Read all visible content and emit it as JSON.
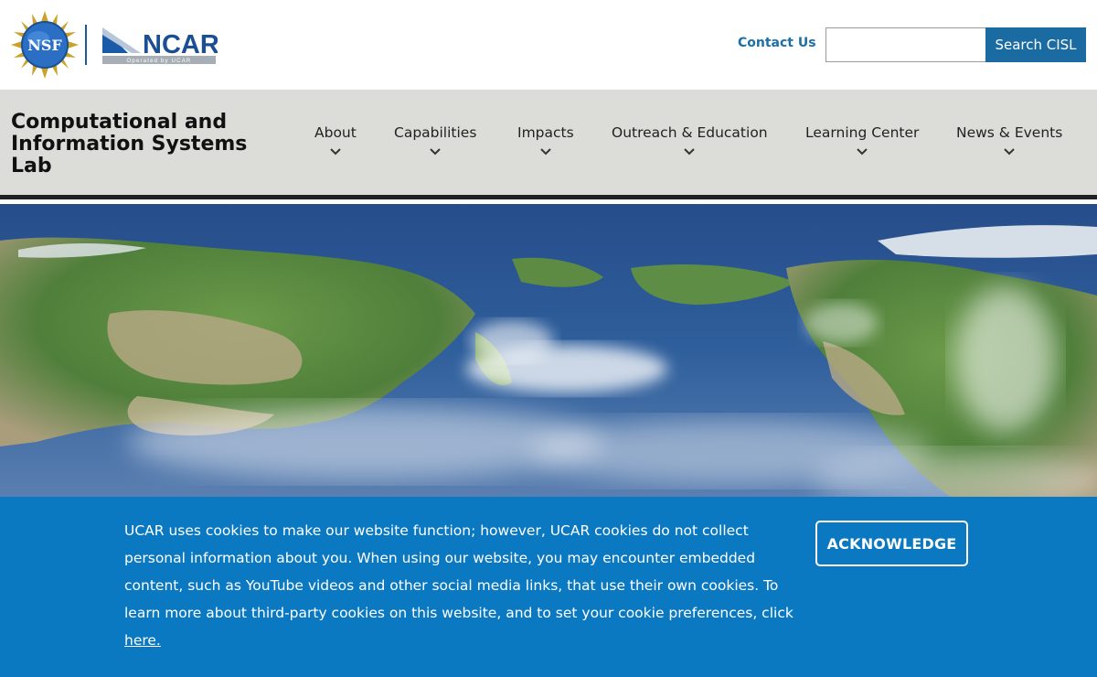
{
  "header": {
    "nsf_logo_text": "NSF",
    "ncar_logo_text": "NCAR",
    "ncar_tagline": "Operated by UCAR",
    "contact_label": "Contact Us",
    "search": {
      "value": "",
      "placeholder": ""
    },
    "search_button_label": "Search CISL"
  },
  "nav": {
    "site_title": "Computational and Information Systems Lab",
    "items": [
      {
        "label": "About",
        "icon": "chevron-down-icon"
      },
      {
        "label": "Capabilities",
        "icon": "chevron-down-icon"
      },
      {
        "label": "Impacts",
        "icon": "chevron-down-icon"
      },
      {
        "label": "Outreach & Education",
        "icon": "chevron-down-icon"
      },
      {
        "label": "Learning Center",
        "icon": "chevron-down-icon"
      },
      {
        "label": "News & Events",
        "icon": "chevron-down-icon"
      }
    ]
  },
  "cookie_banner": {
    "message": "UCAR uses cookies to make our website function; however, UCAR cookies do not collect personal information about you. When using our website, you may encounter embedded content, such as YouTube videos and other social media links, that use their own cookies. To learn more about third-party cookies on this website, and to set your cookie preferences, click",
    "link_label": "here.",
    "button_label": "ACKNOWLEDGE"
  },
  "colors": {
    "brand_blue": "#1b6ba3",
    "banner_blue": "#0b79c1",
    "nav_background": "#dcdcd8",
    "ocean": "#2f5f9c"
  }
}
